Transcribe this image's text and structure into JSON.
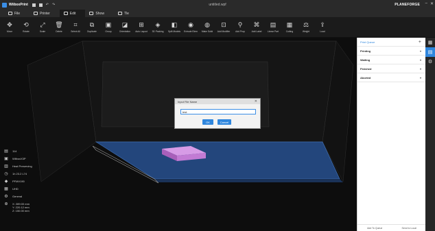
{
  "app": {
    "name": "WiiboxPrint",
    "document_title": "untitled.wpf",
    "brand": "PLANEFORGE"
  },
  "tabs": [
    {
      "label": "File",
      "icon": "folder-icon"
    },
    {
      "label": "Printer",
      "icon": "printer-icon"
    },
    {
      "label": "Edit",
      "icon": "edit-icon",
      "active": true
    },
    {
      "label": "Show",
      "icon": "eye-icon"
    },
    {
      "label": "Tle",
      "icon": "tile-icon"
    }
  ],
  "toolbar": [
    {
      "label": "Move",
      "glyph": "✥"
    },
    {
      "label": "Rotate",
      "glyph": "⟲"
    },
    {
      "label": "Scale",
      "glyph": "⤢"
    },
    {
      "label": "Delete",
      "glyph": "🗑"
    },
    {
      "label": "Select All",
      "glyph": "⌗"
    },
    {
      "label": "Duplicate",
      "glyph": "⧉"
    },
    {
      "label": "Group",
      "glyph": "▣"
    },
    {
      "label": "Orientation",
      "glyph": "◪"
    },
    {
      "label": "Auto Layout",
      "glyph": "⊞"
    },
    {
      "label": "3D Packing",
      "glyph": "◈"
    },
    {
      "label": "Split Models",
      "glyph": "◧"
    },
    {
      "label": "Extrude Elem",
      "glyph": "◉"
    },
    {
      "label": "Make Solid",
      "glyph": "◍"
    },
    {
      "label": "Add Modifier",
      "glyph": "⊡"
    },
    {
      "label": "Add Prop",
      "glyph": "⚲"
    },
    {
      "label": "Add Label",
      "glyph": "⌘"
    },
    {
      "label": "Linear Part",
      "glyph": "▤"
    },
    {
      "label": "Cutting",
      "glyph": "▦"
    },
    {
      "label": "Weight",
      "glyph": "⚖"
    },
    {
      "label": "Load",
      "glyph": "⇪"
    }
  ],
  "dialog": {
    "title": "Input File Name",
    "value": "test",
    "ok_label": "OK",
    "cancel_label": "Cancel"
  },
  "info": {
    "items": [
      {
        "icon": "layers-icon",
        "glyph": "▤",
        "text": "114"
      },
      {
        "icon": "machine-icon",
        "glyph": "▣",
        "text": "WiiboxX3P"
      },
      {
        "icon": "nozzle-icon",
        "glyph": "▥",
        "text": "Heat Preserving"
      },
      {
        "icon": "clock-icon",
        "glyph": "◷",
        "text": "1h 23.2 L74"
      },
      {
        "icon": "weight-icon",
        "glyph": "◆",
        "text": "PFMV190"
      },
      {
        "icon": "material-icon",
        "glyph": "▦",
        "text": "UHD"
      },
      {
        "icon": "gear-icon",
        "glyph": "⚙",
        "text": "General"
      }
    ],
    "dims": {
      "icon": "size-icon",
      "glyph": "⊕",
      "x": "X: 289.00 mm",
      "y": "Y: 220.12 mm",
      "z": "Z: 150.00 mm"
    }
  },
  "panel": {
    "print_queue": "Print Queue",
    "sections": [
      "Printing",
      "Waiting",
      "Finished",
      "Aborted"
    ],
    "footer": {
      "add_to_queue": "Add To Queue",
      "send_to_local": "Send to Local"
    }
  },
  "colors": {
    "accent": "#2f86dd",
    "model": "#c97ad6",
    "bed": "#2c4f85"
  }
}
